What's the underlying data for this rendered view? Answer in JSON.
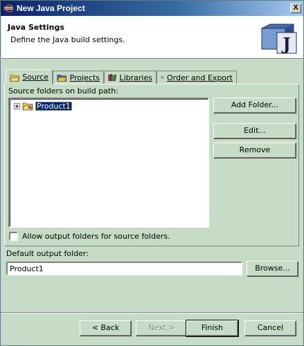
{
  "window": {
    "title": "New Java Project",
    "close_glyph": "X"
  },
  "header": {
    "title": "Java Settings",
    "description": "Define the Java build settings.",
    "logo_letter": "J"
  },
  "tabs": [
    {
      "label": "Source",
      "icon": "source-folder-icon",
      "active": true
    },
    {
      "label": "Projects",
      "icon": "projects-icon",
      "active": false
    },
    {
      "label": "Libraries",
      "icon": "libraries-icon",
      "active": false
    },
    {
      "label": "Order and Export",
      "icon": "order-arrows-icon",
      "active": false
    }
  ],
  "source_tab": {
    "folders_label": "Source folders on build path:",
    "tree": [
      {
        "name": "Product1",
        "expandable": true,
        "selected": true
      }
    ],
    "buttons": {
      "add_folder": "Add Folder...",
      "edit": "Edit...",
      "remove": "Remove"
    },
    "allow_output_label": "Allow output folders for source folders.",
    "allow_output_checked": false
  },
  "output": {
    "label": "Default output folder:",
    "value": "Product1",
    "browse": "Browse..."
  },
  "footer": {
    "back": "< Back",
    "next": "Next >",
    "finish": "Finish",
    "cancel": "Cancel"
  },
  "colors": {
    "background": "#c6dcc6",
    "selection": "#0a246a",
    "titlebar": "#0a246a"
  }
}
